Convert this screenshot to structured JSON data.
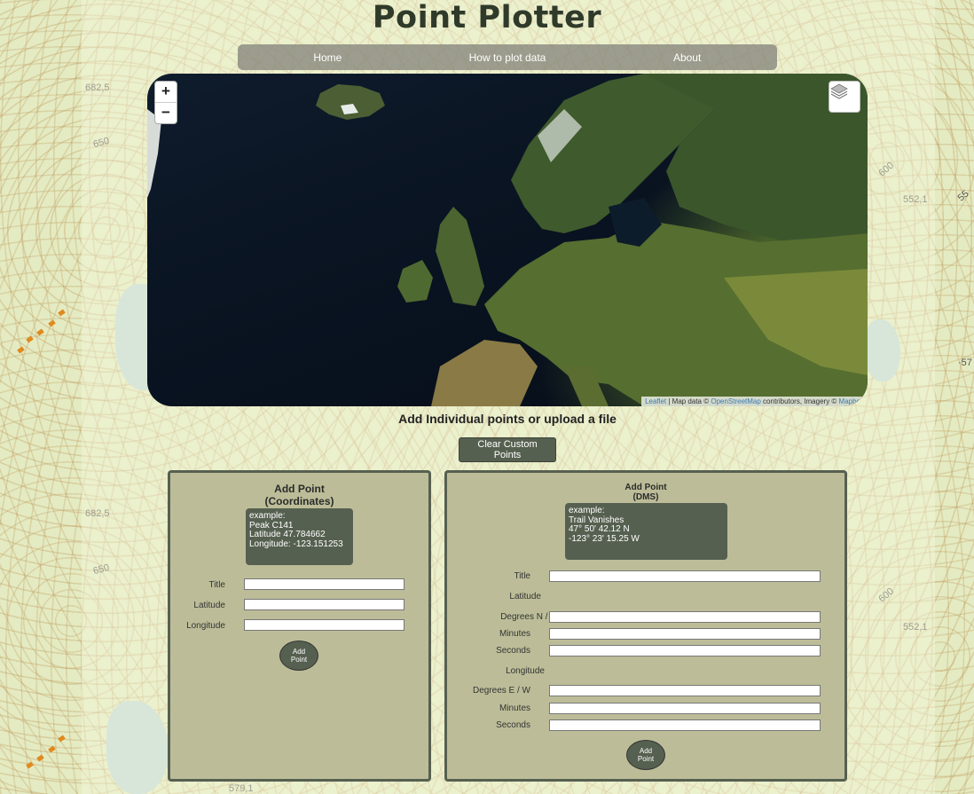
{
  "app": {
    "title": "Point Plotter",
    "subtitle": "Add Individual points or upload a file"
  },
  "nav": {
    "items": [
      {
        "label": "Home"
      },
      {
        "label": "How to plot data"
      },
      {
        "label": "About"
      }
    ]
  },
  "map": {
    "zoom_in": "+",
    "zoom_out": "−",
    "attribution": {
      "leaflet": "Leaflet",
      "sep1": " | Map data © ",
      "osm": "OpenStreetMap",
      "mid": " contributors, Imagery © ",
      "mapbox": "Mapbox"
    }
  },
  "background": {
    "labels": [
      "682,5",
      "650",
      "600",
      "552,1",
      "55",
      "579,1",
      "·57",
      "600"
    ]
  },
  "controls": {
    "clear_label": "Clear Custom Points"
  },
  "coord_panel": {
    "heading_line1": "Add Point",
    "heading_line2": "(Coordinates)",
    "example": [
      "example:",
      "Peak C141",
      "Latitude 47.784662",
      "Longitude: -123.151253"
    ],
    "title_label": "Title",
    "latitude_label": "Latitude",
    "longitude_label": "Longitude",
    "title_value": "",
    "latitude_value": "",
    "longitude_value": "",
    "add_label_line1": "Add",
    "add_label_line2": "Point"
  },
  "dms_panel": {
    "heading_line1": "Add Point",
    "heading_line2": "(DMS)",
    "example": [
      "example:",
      "Trail Vanishes",
      "47° 50' 42.12 N",
      "-123° 23' 15.25 W"
    ],
    "title_label": "Title",
    "latitude_header": "Latitude",
    "lat_degrees_label": "Degrees N / S",
    "lat_minutes_label": "Minutes",
    "lat_seconds_label": "Seconds",
    "longitude_header": "Longitude",
    "lon_degrees_label": "Degrees E / W",
    "lon_minutes_label": "Minutes",
    "lon_seconds_label": "Seconds",
    "add_label_line1": "Add",
    "add_label_line2": "Point"
  }
}
